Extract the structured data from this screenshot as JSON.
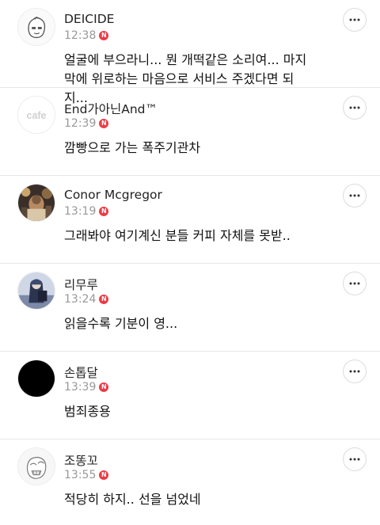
{
  "comments": [
    {
      "author": "DEICIDE",
      "time": "12:38",
      "badge": "N",
      "text": "얼굴에 부으라니... 뭔 개떡같은 소리여... 마지막에 위로하는 마음으로 서비스 주겠다면 되지...",
      "avatar_icon": "cartoon-face-avatar"
    },
    {
      "author": "End가아닌And™",
      "time": "12:39",
      "badge": "N",
      "text": "깜빵으로 가는 폭주기관차",
      "avatar_icon": "cafe-default-avatar",
      "avatar_text": "cafe"
    },
    {
      "author": "Conor Mcgregor",
      "time": "13:19",
      "badge": "N",
      "text": "그래봐야 여기계신 분들 커피 자체를 못받..",
      "avatar_icon": "photo-avatar"
    },
    {
      "author": "리무루",
      "time": "13:24",
      "badge": "N",
      "text": "읽을수록 기분이 영...",
      "avatar_icon": "character-photo-avatar"
    },
    {
      "author": "손톱달",
      "time": "13:39",
      "badge": "N",
      "text": "범죄종용",
      "avatar_icon": "crescent-moon-avatar"
    },
    {
      "author": "조똥꼬",
      "time": "13:55",
      "badge": "N",
      "text": "적당히 하지.. 선을 넘었네",
      "avatar_icon": "sketch-face-avatar"
    }
  ],
  "colors": {
    "badge": "#ec3b47",
    "time": "#999999",
    "divider": "#e6e6e6"
  },
  "more_icon": "more-options-icon"
}
